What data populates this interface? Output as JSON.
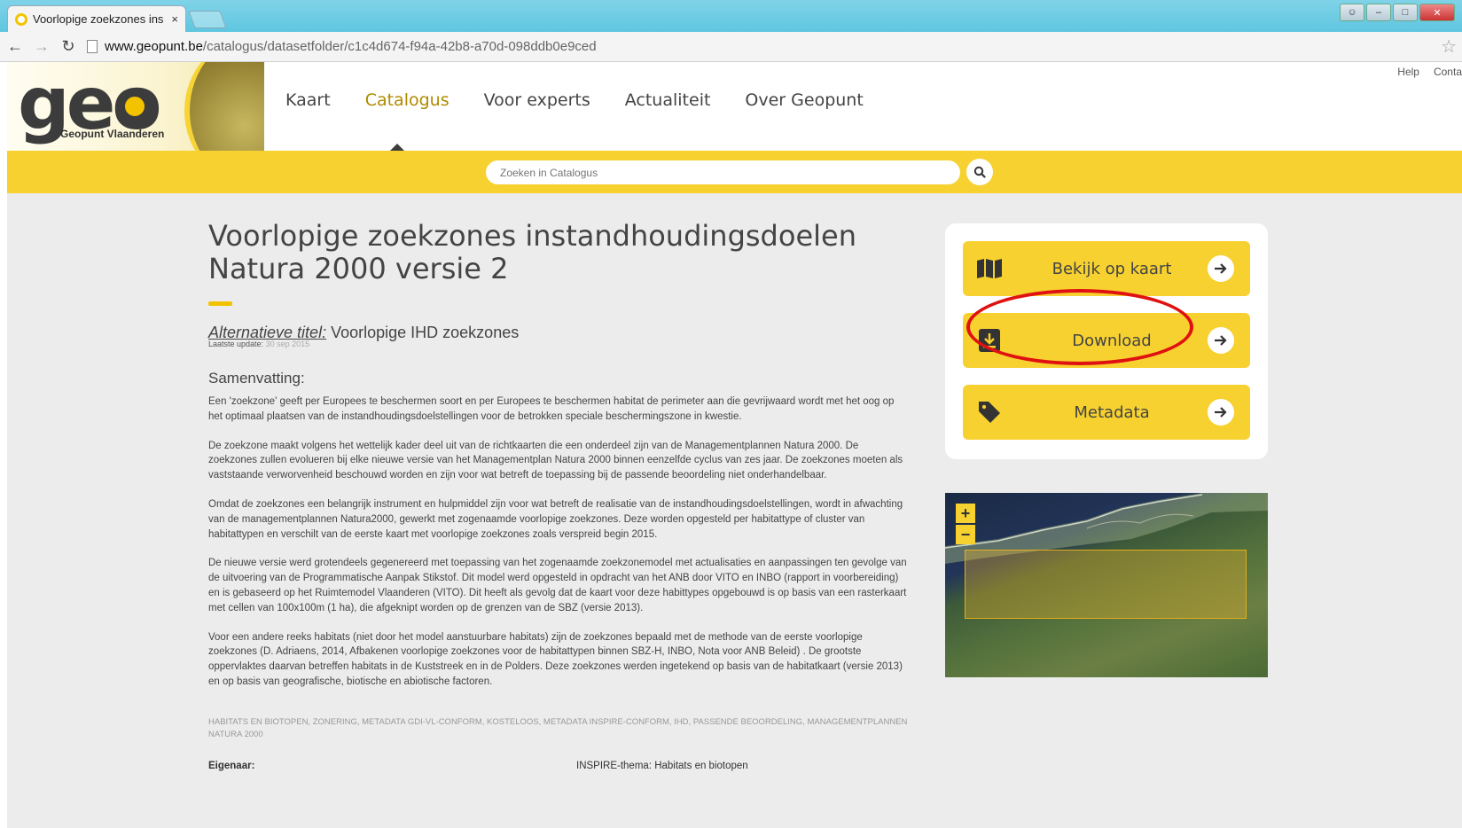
{
  "browser": {
    "tab_title": "Voorlopige zoekzones ins",
    "tab_close": "×",
    "url_host": "www.geopunt.be",
    "url_path": "/catalogus/datasetfolder/c1c4d674-f94a-42b8-a70d-098ddb0e9ced"
  },
  "header": {
    "logo_text": "geo",
    "logo_subtitle": "Geopunt Vlaanderen",
    "nav": [
      "Kaart",
      "Catalogus",
      "Voor experts",
      "Actualiteit",
      "Over Geopunt"
    ],
    "active_nav": "Catalogus",
    "top_links": [
      "Help",
      "Conta"
    ]
  },
  "search": {
    "placeholder": "Zoeken in Catalogus"
  },
  "dataset": {
    "title": "Voorlopige zoekzones instandhoudingsdoelen Natura 2000 versie 2",
    "alt_title_label": "Alternatieve titel:",
    "alt_title_value": "Voorlopige IHD zoekzones",
    "last_update_label": "Laatste update:",
    "last_update_value": "30 sep 2015",
    "summary_heading": "Samenvatting:",
    "paragraphs": [
      "Een 'zoekzone' geeft per Europees te beschermen soort en per Europees te beschermen habitat de perimeter aan die gevrijwaard wordt met het oog op het optimaal plaatsen van de instandhoudingsdoelstellingen voor de betrokken speciale beschermingszone in kwestie.",
      "De zoekzone maakt volgens het wettelijk kader deel uit van de richtkaarten die een onderdeel zijn van de Managementplannen Natura 2000. De zoekzones zullen evolueren bij elke nieuwe versie van het Managementplan Natura 2000 binnen eenzelfde cyclus van zes jaar. De zoekzones moeten als vaststaande verworvenheid beschouwd worden en zijn voor wat betreft de toepassing bij de passende beoordeling niet onderhandelbaar.",
      "Omdat de zoekzones een belangrijk instrument en hulpmiddel zijn voor wat betreft de realisatie van de instandhoudingsdoelstellingen, wordt in afwachting van de managementplannen Natura2000, gewerkt met zogenaamde voorlopige zoekzones. Deze worden opgesteld per habitattype of cluster van habitattypen en verschilt van de eerste kaart met voorlopige zoekzones zoals verspreid begin 2015.",
      "De nieuwe versie werd grotendeels gegenereerd met toepassing van het zogenaamde zoekzonemodel met actualisaties en aanpassingen ten gevolge van de uitvoering van de Programmatische Aanpak Stikstof. Dit model werd opgesteld in opdracht van het ANB door VITO en INBO (rapport in voorbereiding) en is gebaseerd op het Ruimtemodel Vlaanderen (VITO). Dit heeft als gevolg dat de kaart voor deze habittypes opgebouwd is op basis van een rasterkaart met cellen van 100x100m (1 ha), die afgeknipt worden op de grenzen van de SBZ (versie 2013).",
      "Voor een andere reeks habitats (niet door het model aanstuurbare habitats) zijn de zoekzones bepaald met de methode van de eerste voorlopige zoekzones (D. Adriaens, 2014, Afbakenen voorlopige zoekzones voor de habitattypen binnen SBZ-H, INBO, Nota voor ANB Beleid) . De grootste oppervlaktes daarvan betreffen habitats in de Kuststreek en in de Polders. Deze zoekzones werden ingetekend op basis van de habitatkaart (versie 2013) en op basis van geografische, biotische en abiotische factoren."
    ],
    "tags": "HABITATS EN BIOTOPEN, ZONERING, METADATA GDI-VL-CONFORM, KOSTELOOS, METADATA INSPIRE-CONFORM, IHD, PASSENDE BEOORDELING, MANAGEMENTPLANNEN NATURA 2000",
    "owner_label": "Eigenaar:",
    "inspire_theme": "INSPIRE-thema: Habitats en biotopen"
  },
  "actions": [
    {
      "label": "Bekijk op kaart",
      "icon": "map-book-icon"
    },
    {
      "label": "Download",
      "icon": "download-icon"
    },
    {
      "label": "Metadata",
      "icon": "tag-icon"
    }
  ],
  "map": {
    "zoom_in": "+",
    "zoom_out": "−"
  },
  "colors": {
    "accent": "#f7d12f",
    "highlight_ring": "#e01111"
  }
}
